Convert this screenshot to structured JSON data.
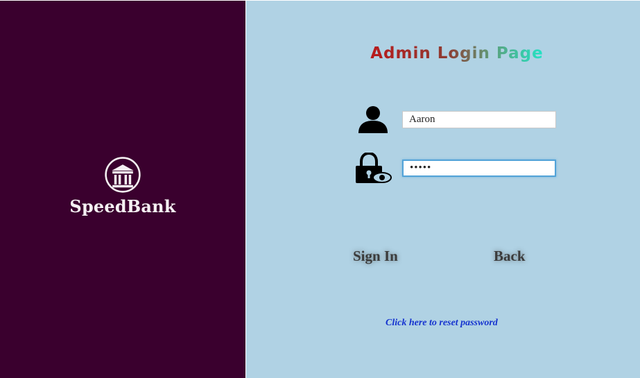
{
  "brand": {
    "name": "SpeedBank",
    "logo_icon": "bank-building-icon"
  },
  "page": {
    "title": "Admin Login Page",
    "title_words": [
      "Admin",
      "Login",
      "Page"
    ],
    "title_colors": [
      "#b81a1c",
      "#7a4a3e",
      "#4eab8a"
    ]
  },
  "form": {
    "username_icon": "user-icon",
    "username_value": "Aaron",
    "password_icon": "lock-eye-icon",
    "password_value": "•••••"
  },
  "buttons": {
    "sign_in": "Sign In",
    "back": "Back"
  },
  "links": {
    "reset_password": "Click here to reset password"
  },
  "colors": {
    "left_panel": "#3a002e",
    "right_panel": "#b0d2e4",
    "link": "#1533cf"
  }
}
